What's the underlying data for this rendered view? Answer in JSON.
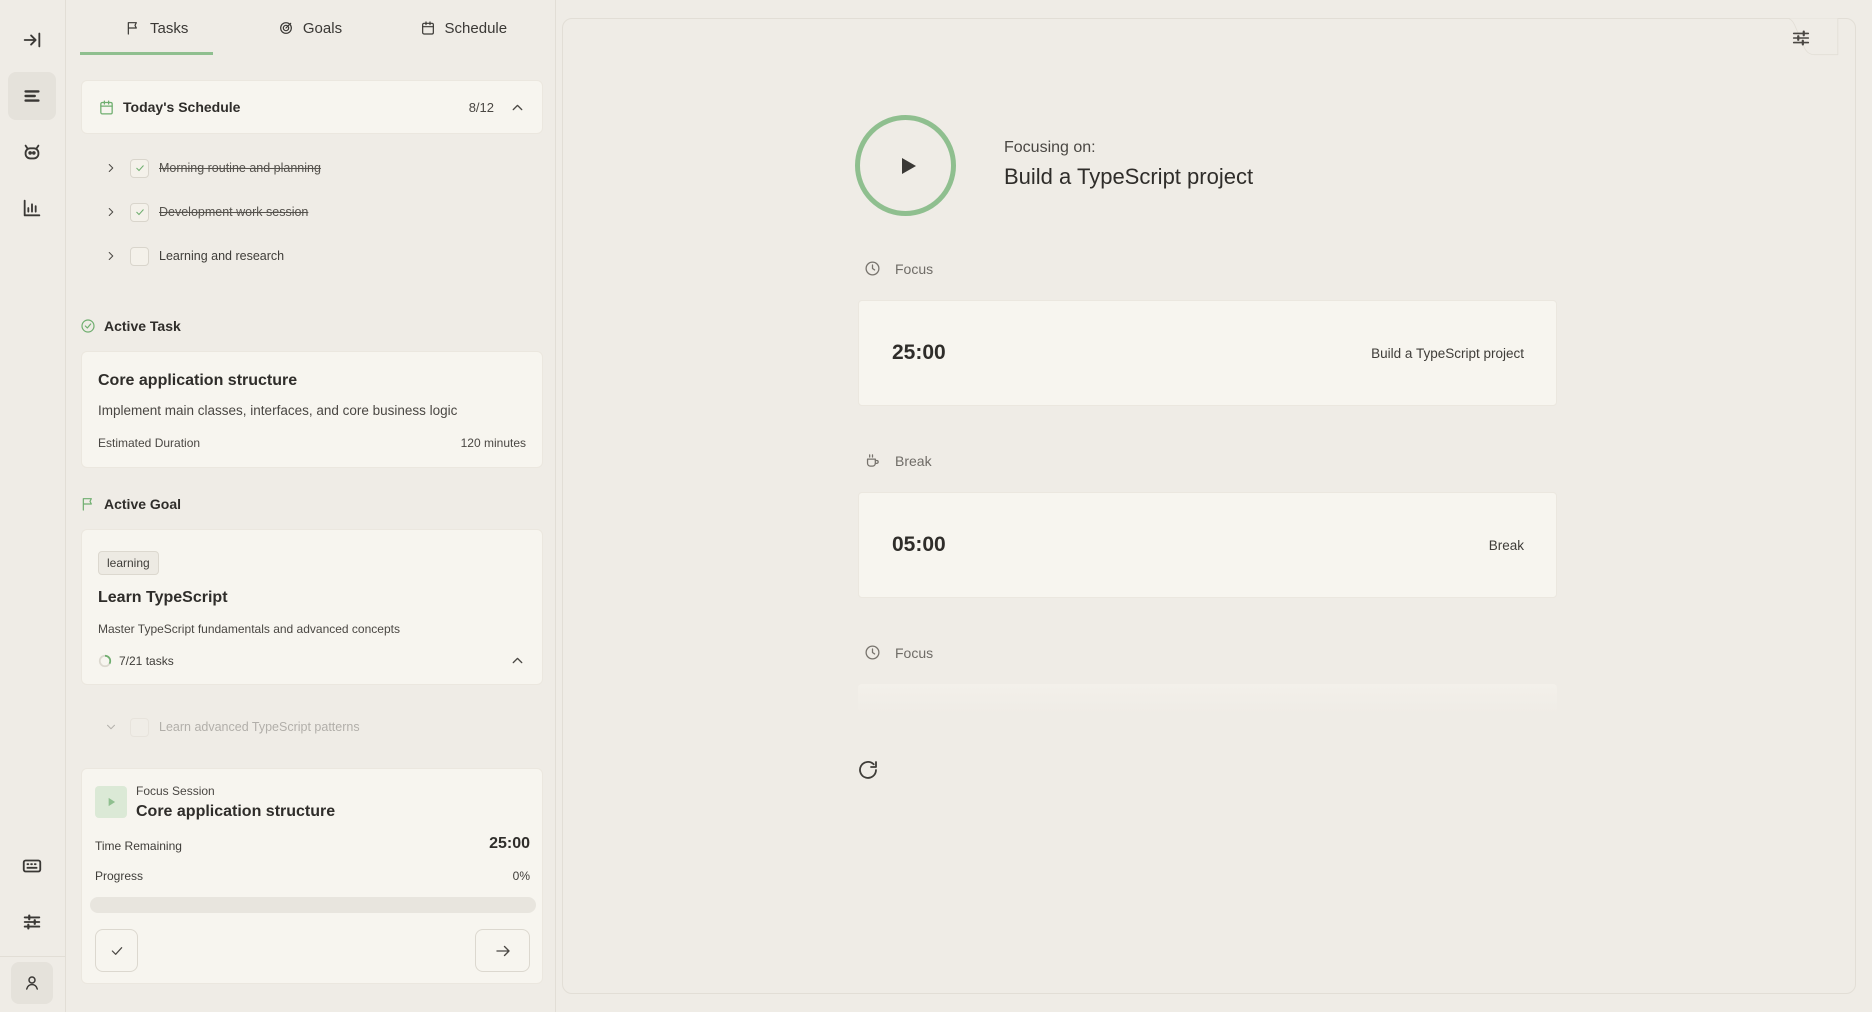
{
  "tabs": [
    {
      "label": "Tasks",
      "icon": "flag-icon"
    },
    {
      "label": "Goals",
      "icon": "target-icon"
    },
    {
      "label": "Schedule",
      "icon": "calendar-icon"
    }
  ],
  "schedule": {
    "title": "Today's Schedule",
    "count": "8/12",
    "items": [
      {
        "label": "Morning routine and planning",
        "done": true
      },
      {
        "label": "Development work session",
        "done": true
      },
      {
        "label": "Learning and research",
        "done": false
      }
    ]
  },
  "active_task": {
    "heading": "Active Task",
    "title": "Core application structure",
    "description": "Implement main classes, interfaces, and core business logic",
    "duration_label": "Estimated Duration",
    "duration_value": "120 minutes"
  },
  "active_goal": {
    "heading": "Active Goal",
    "tag": "learning",
    "title": "Learn TypeScript",
    "description": "Master TypeScript fundamentals and advanced concepts",
    "progress_text": "7/21 tasks",
    "progress_fraction": 0.333,
    "subtask": "Learn advanced TypeScript patterns"
  },
  "focus_session": {
    "label": "Focus Session",
    "title": "Core application structure",
    "time_label": "Time Remaining",
    "time_value": "25:00",
    "progress_label": "Progress",
    "progress_value": "0%",
    "progress_fraction": 0
  },
  "main": {
    "focusing_label": "Focusing on:",
    "focusing_title": "Build a TypeScript project",
    "segments": [
      {
        "type": "Focus",
        "time": "25:00",
        "note": "Build a TypeScript project"
      },
      {
        "type": "Break",
        "time": "05:00",
        "note": "Break"
      },
      {
        "type": "Focus",
        "time": "",
        "note": ""
      }
    ]
  },
  "colors": {
    "accent": "#8fbf8f",
    "background": "#efece6",
    "card": "#f7f5ef"
  }
}
